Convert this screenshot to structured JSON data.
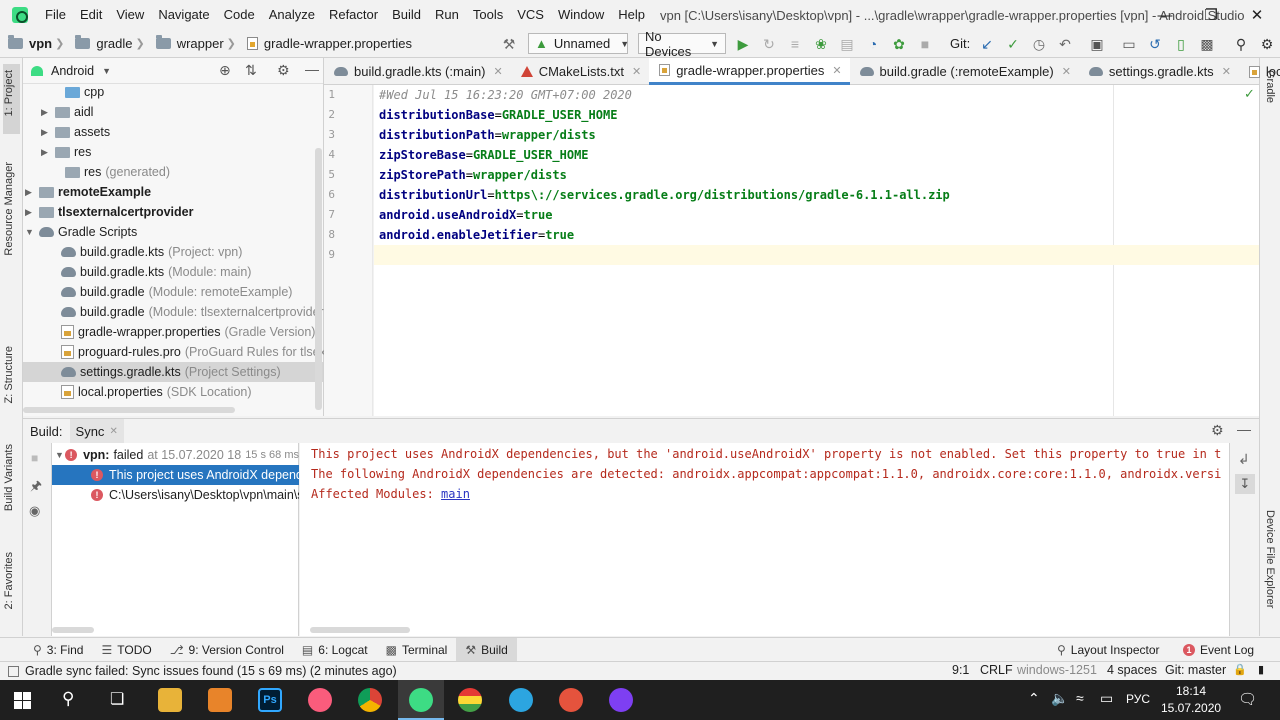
{
  "menu": {
    "items": [
      "File",
      "Edit",
      "View",
      "Navigate",
      "Code",
      "Analyze",
      "Refactor",
      "Build",
      "Run",
      "Tools",
      "VCS",
      "Window",
      "Help"
    ],
    "window_title": "vpn [C:\\Users\\isany\\Desktop\\vpn] - ...\\gradle\\wrapper\\gradle-wrapper.properties [vpn] - Android Studio"
  },
  "navbar": {
    "crumbs": [
      "vpn",
      "gradle",
      "wrapper",
      "gradle-wrapper.properties"
    ],
    "run_config": "Unnamed",
    "devices": "No Devices",
    "git_label": "Git:"
  },
  "left_strip": {
    "project": "1: Project",
    "resource_manager": "Resource Manager",
    "structure": "Z: Structure",
    "build_variants": "Build Variants",
    "favorites": "2: Favorites"
  },
  "right_strip": {
    "gradle": "Gradle",
    "device_file_explorer": "Device File Explorer"
  },
  "project_panel": {
    "view": "Android",
    "tree": [
      {
        "label": "cpp",
        "hint": ""
      },
      {
        "label": "aidl",
        "hint": ""
      },
      {
        "label": "assets",
        "hint": ""
      },
      {
        "label": "res",
        "hint": ""
      },
      {
        "label": "res",
        "hint": "(generated)"
      },
      {
        "label": "remoteExample",
        "hint": ""
      },
      {
        "label": "tlsexternalcertprovider",
        "hint": ""
      },
      {
        "label": "Gradle Scripts",
        "hint": ""
      },
      {
        "label": "build.gradle.kts",
        "hint": "(Project: vpn)"
      },
      {
        "label": "build.gradle.kts",
        "hint": "(Module: main)"
      },
      {
        "label": "build.gradle",
        "hint": "(Module: remoteExample)"
      },
      {
        "label": "build.gradle",
        "hint": "(Module: tlsexternalcertprovider)"
      },
      {
        "label": "gradle-wrapper.properties",
        "hint": "(Gradle Version)"
      },
      {
        "label": "proguard-rules.pro",
        "hint": "(ProGuard Rules for tlsexte"
      },
      {
        "label": "settings.gradle.kts",
        "hint": "(Project Settings)"
      },
      {
        "label": "local.properties",
        "hint": "(SDK Location)"
      }
    ]
  },
  "editor": {
    "tabs": [
      "build.gradle.kts (:main)",
      "CMakeLists.txt",
      "gradle-wrapper.properties",
      "build.gradle (:remoteExample)",
      "settings.gradle.kts",
      "loca"
    ],
    "overflow": "≡4",
    "line_numbers": [
      "1",
      "2",
      "3",
      "4",
      "5",
      "6",
      "7",
      "8",
      "9"
    ],
    "comment": "#Wed Jul 15 16:23:20 GMT+07:00 2020",
    "lines": [
      {
        "key": "distributionBase",
        "value": "GRADLE_USER_HOME"
      },
      {
        "key": "distributionPath",
        "value": "wrapper/dists"
      },
      {
        "key": "zipStoreBase",
        "value": "GRADLE_USER_HOME"
      },
      {
        "key": "zipStorePath",
        "value": "wrapper/dists"
      },
      {
        "key": "distributionUrl",
        "value": "https\\://services.gradle.org/distributions/gradle-6.1.1-all.zip"
      },
      {
        "key": "android.useAndroidX",
        "value": "true"
      },
      {
        "key": "android.enableJetifier",
        "value": "true"
      }
    ]
  },
  "build": {
    "label": "Build:",
    "tab": "Sync",
    "root_name": "vpn:",
    "root_status": "failed",
    "root_time": "at 15.07.2020 18",
    "root_duration": "15 s 68 ms",
    "item1": "This project uses AndroidX depende",
    "item2": "C:\\Users\\isany\\Desktop\\vpn\\main\\s",
    "output": [
      "This project uses AndroidX dependencies, but the 'android.useAndroidX' property is not enabled. Set this property to true in t",
      "The following AndroidX dependencies are detected: androidx.appcompat:appcompat:1.1.0, androidx.core:core:1.1.0, androidx.versi"
    ],
    "affected_label": "Affected Modules: ",
    "affected_link": "main"
  },
  "bottom_tabs": [
    "3: Find",
    "TODO",
    "9: Version Control",
    "6: Logcat",
    "Terminal",
    "Build"
  ],
  "bottom_right": {
    "layout_inspector": "Layout Inspector",
    "event_log": "Event Log"
  },
  "status": {
    "message": "Gradle sync failed: Sync issues found (15 s 69 ms) (2 minutes ago)",
    "position": "9:1",
    "line_sep": "CRLF",
    "encoding": "windows-1251",
    "indent": "4 spaces",
    "git": "Git: master"
  },
  "taskbar": {
    "lang": "РУС",
    "time": "18:14",
    "date": "15.07.2020"
  }
}
